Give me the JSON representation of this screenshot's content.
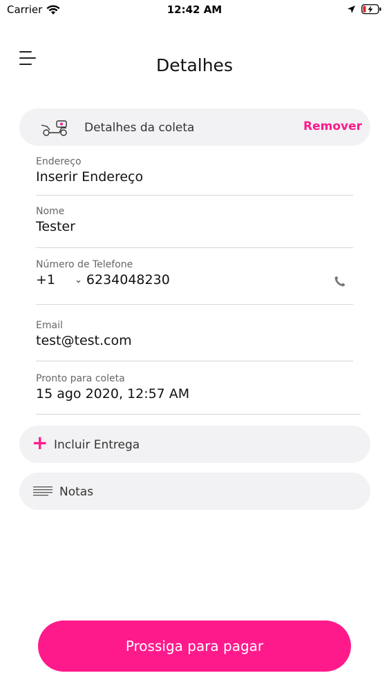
{
  "status_bar": {
    "carrier": "Carrier",
    "time": "12:42 AM"
  },
  "header": {
    "title": "Detalhes"
  },
  "pickup": {
    "section_title": "Detalhes da coleta",
    "remove_label": "Remover",
    "address": {
      "label": "Endereço",
      "value": "Inserir Endereço"
    },
    "name": {
      "label": "Nome",
      "value": "Tester"
    },
    "phone": {
      "label": "Número de Telefone",
      "country_code": "+1",
      "number": "6234048230"
    },
    "email": {
      "label": "Email",
      "value": "test@test.com"
    },
    "ready": {
      "label": "Pronto para coleta",
      "value": "15 ago 2020, 12:57 AM"
    }
  },
  "add_delivery": {
    "label": "Incluir Entrega",
    "icon": "plus-icon"
  },
  "notes": {
    "label": "Notas",
    "icon": "notes-lines-icon"
  },
  "pay_button": {
    "label": "Prossiga para pagar"
  },
  "colors": {
    "accent": "#ff1a8c",
    "section_bg": "#f2f1f3",
    "divider": "#d6d6d6"
  }
}
